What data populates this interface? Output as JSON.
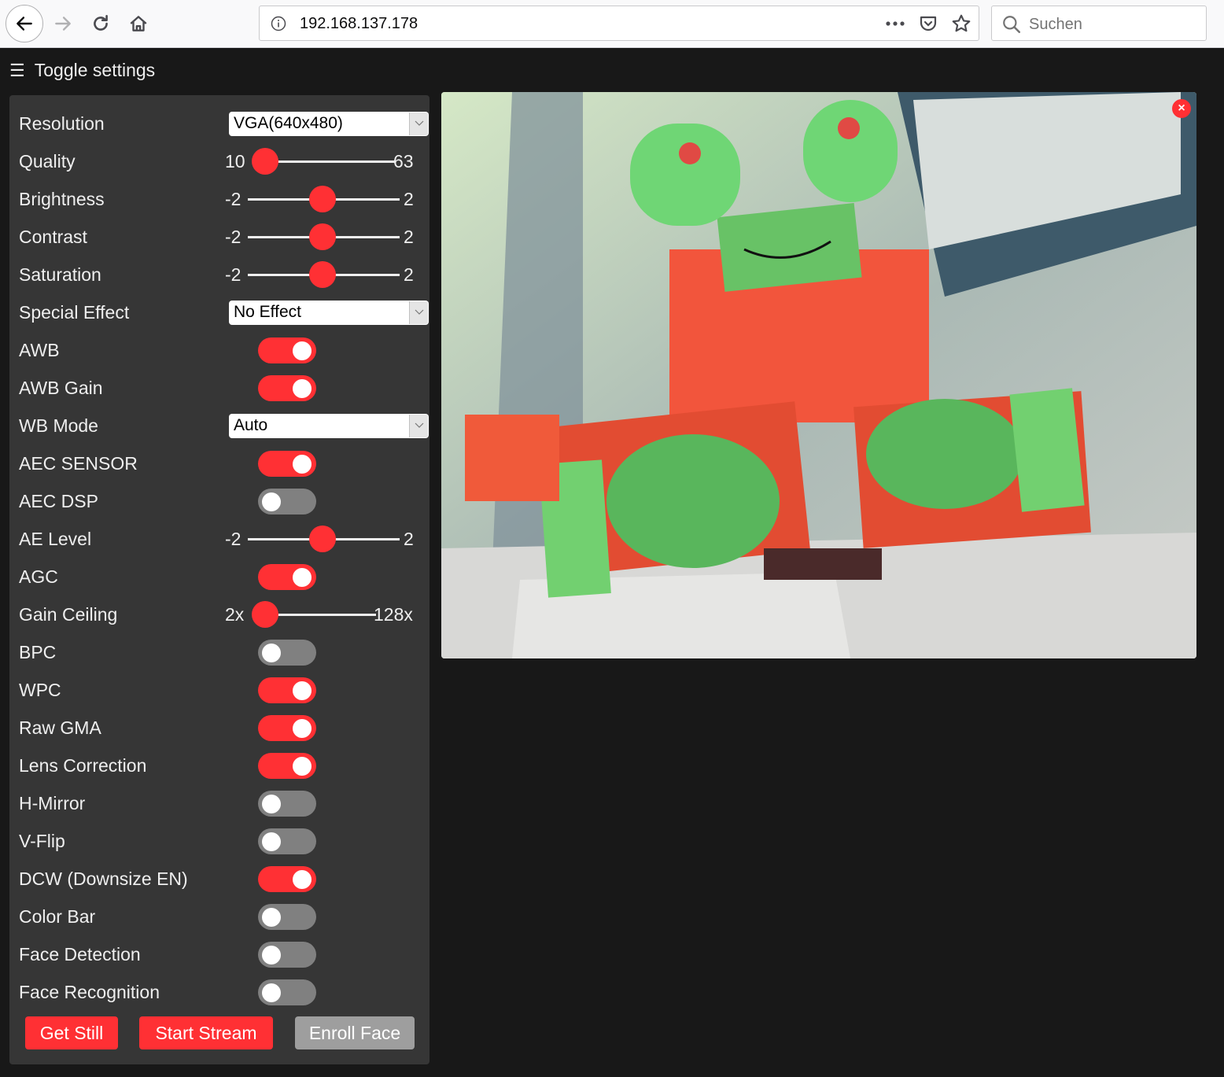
{
  "browser": {
    "url": "192.168.137.178",
    "search_placeholder": "Suchen"
  },
  "page": {
    "toggle_settings_label": "Toggle settings",
    "accent_color": "#ff3034",
    "settings": {
      "resolution": {
        "label": "Resolution",
        "value": "VGA(640x480)"
      },
      "quality": {
        "label": "Quality",
        "min": "10",
        "max": "63",
        "value": 10
      },
      "brightness": {
        "label": "Brightness",
        "min": "-2",
        "max": "2",
        "value": 0
      },
      "contrast": {
        "label": "Contrast",
        "min": "-2",
        "max": "2",
        "value": 0
      },
      "saturation": {
        "label": "Saturation",
        "min": "-2",
        "max": "2",
        "value": 0
      },
      "special_effect": {
        "label": "Special Effect",
        "value": "No Effect"
      },
      "awb": {
        "label": "AWB",
        "on": true
      },
      "awb_gain": {
        "label": "AWB Gain",
        "on": true
      },
      "wb_mode": {
        "label": "WB Mode",
        "value": "Auto"
      },
      "aec_sensor": {
        "label": "AEC SENSOR",
        "on": true
      },
      "aec_dsp": {
        "label": "AEC DSP",
        "on": false
      },
      "ae_level": {
        "label": "AE Level",
        "min": "-2",
        "max": "2",
        "value": 0
      },
      "agc": {
        "label": "AGC",
        "on": true
      },
      "gain_ceiling": {
        "label": "Gain Ceiling",
        "min": "2x",
        "max": "128x",
        "value": 0
      },
      "bpc": {
        "label": "BPC",
        "on": false
      },
      "wpc": {
        "label": "WPC",
        "on": true
      },
      "raw_gma": {
        "label": "Raw GMA",
        "on": true
      },
      "lens_correction": {
        "label": "Lens Correction",
        "on": true
      },
      "hmirror": {
        "label": "H-Mirror",
        "on": false
      },
      "vflip": {
        "label": "V-Flip",
        "on": false
      },
      "dcw": {
        "label": "DCW (Downsize EN)",
        "on": true
      },
      "colorbar": {
        "label": "Color Bar",
        "on": false
      },
      "face_detect": {
        "label": "Face Detection",
        "on": false
      },
      "face_recognize": {
        "label": "Face Recognition",
        "on": false
      }
    },
    "buttons": {
      "get_still": "Get Still",
      "start_stream": "Start Stream",
      "enroll_face": "Enroll Face"
    },
    "stream": {
      "close_label": "×",
      "description": "Camera stream showing a red and green toy robot"
    }
  }
}
